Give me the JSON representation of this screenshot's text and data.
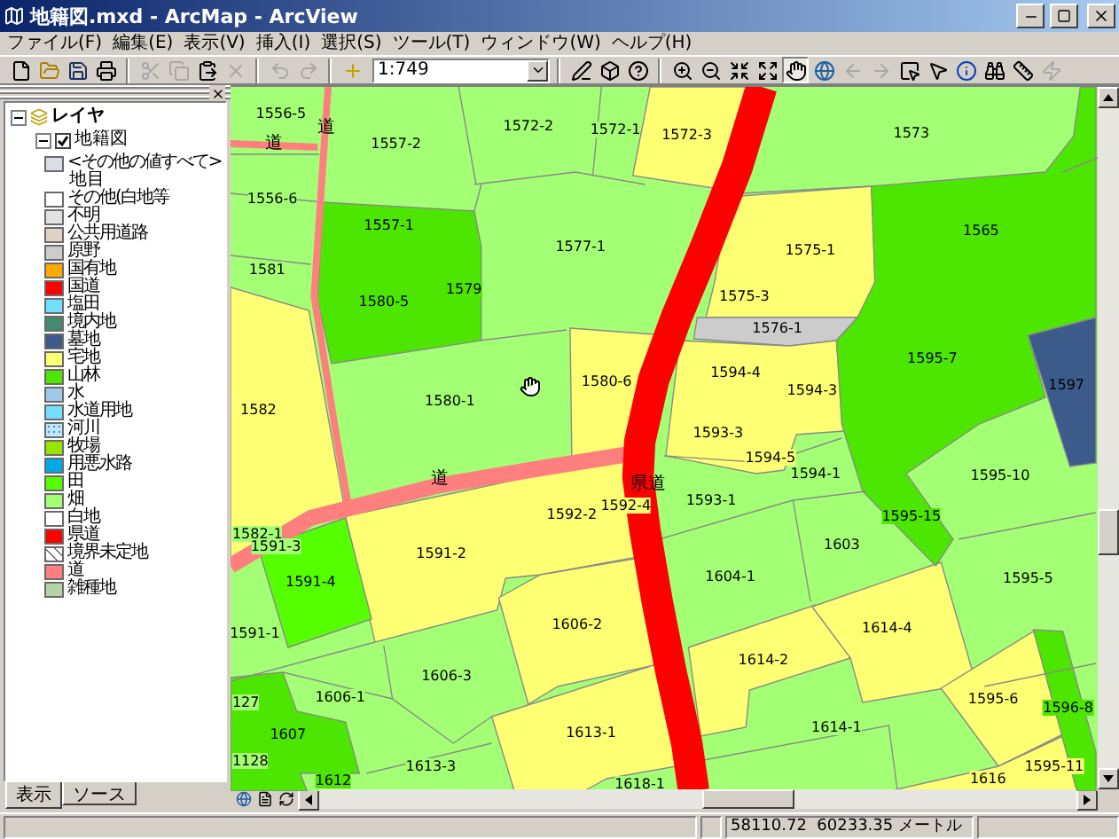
{
  "window": {
    "title": "地籍図.mxd - ArcMap - ArcView"
  },
  "menu": [
    "ファイル(F)",
    "編集(E)",
    "表示(V)",
    "挿入(I)",
    "選択(S)",
    "ツール(T)",
    "ウィンドウ(W)",
    "ヘルプ(H)"
  ],
  "toolbar": {
    "groups": [
      {
        "kind": "buttons",
        "buttons": [
          {
            "kind": "new",
            "disabled": false,
            "selected": false
          },
          {
            "kind": "open",
            "disabled": false,
            "selected": false
          },
          {
            "kind": "save",
            "disabled": false,
            "selected": false
          },
          {
            "kind": "print",
            "disabled": false,
            "selected": false
          }
        ]
      },
      {
        "kind": "buttons",
        "buttons": [
          {
            "kind": "cut",
            "disabled": true,
            "selected": false
          },
          {
            "kind": "copy",
            "disabled": true,
            "selected": false
          },
          {
            "kind": "paste",
            "disabled": false,
            "selected": false
          },
          {
            "kind": "delete",
            "disabled": true,
            "selected": false
          }
        ]
      },
      {
        "kind": "buttons",
        "buttons": [
          {
            "kind": "undo",
            "disabled": true,
            "selected": false
          },
          {
            "kind": "redo",
            "disabled": true,
            "selected": false
          }
        ]
      },
      {
        "kind": "buttons",
        "buttons": [
          {
            "kind": "add",
            "disabled": false,
            "selected": false
          }
        ]
      },
      {
        "kind": "scale",
        "value": "1:749"
      },
      {
        "kind": "buttons",
        "buttons": [
          {
            "kind": "editor",
            "disabled": false,
            "selected": false
          },
          {
            "kind": "toolbox",
            "disabled": false,
            "selected": false
          },
          {
            "kind": "help",
            "disabled": false,
            "selected": false
          }
        ]
      },
      {
        "kind": "buttons",
        "buttons": [
          {
            "kind": "zoomin",
            "disabled": false,
            "selected": false
          },
          {
            "kind": "zoomout",
            "disabled": false,
            "selected": false
          },
          {
            "kind": "fixedin",
            "disabled": false,
            "selected": false
          },
          {
            "kind": "fixedout",
            "disabled": false,
            "selected": false
          },
          {
            "kind": "pan",
            "disabled": false,
            "selected": true
          },
          {
            "kind": "globe",
            "disabled": false,
            "selected": false
          },
          {
            "kind": "back",
            "disabled": true,
            "selected": false
          },
          {
            "kind": "forward",
            "disabled": true,
            "selected": false
          },
          {
            "kind": "selectfeatures",
            "disabled": false,
            "selected": false
          },
          {
            "kind": "pointer",
            "disabled": false,
            "selected": false
          },
          {
            "kind": "identify",
            "disabled": false,
            "selected": false
          },
          {
            "kind": "find",
            "disabled": false,
            "selected": false
          },
          {
            "kind": "measure",
            "disabled": false,
            "selected": false
          },
          {
            "kind": "hyperlink",
            "disabled": true,
            "selected": false
          }
        ]
      }
    ]
  },
  "layers": {
    "label": "レイヤ",
    "expanded": true,
    "children": [
      {
        "label": "地籍図",
        "expanded": true,
        "checked": true,
        "default_symbol": {
          "label": "<その他の値すべて>",
          "color": "#dcdce6"
        },
        "field": "地目",
        "legend": [
          {
            "label": "その他(白地等",
            "color": "#ffffff",
            "kind": "fill"
          },
          {
            "label": "不明",
            "color": "#e1e1e1",
            "kind": "fill"
          },
          {
            "label": "公共用道路",
            "color": "#e1d2c8",
            "kind": "fill"
          },
          {
            "label": "原野",
            "color": "#cccccc",
            "kind": "fill"
          },
          {
            "label": "国有地",
            "color": "#ffaa00",
            "kind": "fill"
          },
          {
            "label": "国道",
            "color": "#ff0000",
            "kind": "fill"
          },
          {
            "label": "塩田",
            "color": "#73dfff",
            "kind": "fill"
          },
          {
            "label": "境内地",
            "color": "#448970",
            "kind": "fill"
          },
          {
            "label": "墓地",
            "color": "#3d5b8a",
            "kind": "fill"
          },
          {
            "label": "宅地",
            "color": "#ffff73",
            "kind": "fill"
          },
          {
            "label": "山林",
            "color": "#4ce600",
            "kind": "fill"
          },
          {
            "label": "水",
            "color": "#a0c8e8",
            "kind": "fill"
          },
          {
            "label": "水道用地",
            "color": "#73dfff",
            "kind": "fill"
          },
          {
            "label": "河川",
            "color": "#bee8ff",
            "kind": "dotted"
          },
          {
            "label": "牧場",
            "color": "#98e600",
            "kind": "fill"
          },
          {
            "label": "用悪水路",
            "color": "#00a9e6",
            "kind": "fill"
          },
          {
            "label": "田",
            "color": "#55ff00",
            "kind": "fill"
          },
          {
            "label": "畑",
            "color": "#a3ff73",
            "kind": "fill"
          },
          {
            "label": "白地",
            "color": "#ffffff",
            "kind": "fill"
          },
          {
            "label": "県道",
            "color": "#ff0000",
            "kind": "fill"
          },
          {
            "label": "境界未定地",
            "color": "#ffffff",
            "kind": "hatched"
          },
          {
            "label": "道",
            "color": "#ff7f7f",
            "kind": "fill"
          },
          {
            "label": "雑種地",
            "color": "#b4d2a8",
            "kind": "fill"
          }
        ]
      }
    ]
  },
  "panel_tabs": [
    {
      "label": "表示",
      "selected": true
    },
    {
      "label": "ソース",
      "selected": false
    }
  ],
  "map": {
    "roads": [
      {
        "label": "道",
        "color": "#ff7f7f"
      },
      {
        "label": "道",
        "color": "#ff7f7f"
      },
      {
        "label": "道",
        "color": "#ff7f7f"
      },
      {
        "label": "県道",
        "color": "#ff0000"
      }
    ],
    "parcels": [
      {
        "label": "1556-5",
        "color": "#a3ff73"
      },
      {
        "label": "1557-2",
        "color": "#a3ff73"
      },
      {
        "label": "1572-2",
        "color": "#a3ff73"
      },
      {
        "label": "1572-1",
        "color": "#a3ff73"
      },
      {
        "label": "1572-3",
        "color": "#ffff73"
      },
      {
        "label": "1573",
        "color": "#a3ff73"
      },
      {
        "label": "1556-6",
        "color": "#a3ff73"
      },
      {
        "label": "1557-1",
        "color": "#4ce600"
      },
      {
        "label": "1565",
        "color": "#4ce600"
      },
      {
        "label": "1577-1",
        "color": "#a3ff73"
      },
      {
        "label": "1575-1",
        "color": "#ffff73"
      },
      {
        "label": "1581",
        "color": "#a3ff73"
      },
      {
        "label": "1579",
        "color": "#4ce600"
      },
      {
        "label": "1575-3",
        "color": "#ffff73"
      },
      {
        "label": "1580-5",
        "color": "#4ce600"
      },
      {
        "label": "1576-1",
        "color": "#cccccc"
      },
      {
        "label": "1595-7",
        "color": "#4ce600"
      },
      {
        "label": "1580-6",
        "color": "#ffff73"
      },
      {
        "label": "1594-4",
        "color": "#ffff73"
      },
      {
        "label": "1597",
        "color": "#3d5b8a"
      },
      {
        "label": "1594-3",
        "color": "#ffff73"
      },
      {
        "label": "1580-1",
        "color": "#a3ff73"
      },
      {
        "label": "1582",
        "color": "#ffff73"
      },
      {
        "label": "1593-3",
        "color": "#ffff73"
      },
      {
        "label": "1594-5",
        "color": "#ffff73"
      },
      {
        "label": "1594-1",
        "color": "#a3ff73"
      },
      {
        "label": "1595-10",
        "color": "#a3ff73"
      },
      {
        "label": "1593-1",
        "color": "#a3ff73"
      },
      {
        "label": "1592-4",
        "color": "#ffff73"
      },
      {
        "label": "1592-2",
        "color": "#ffff73"
      },
      {
        "label": "1595-15",
        "color": "#4ce600"
      },
      {
        "label": "1582-1",
        "color": "#a3ff73"
      },
      {
        "label": "1591-3",
        "color": "#a3ff73"
      },
      {
        "label": "1603",
        "color": "#a3ff73"
      },
      {
        "label": "1591-2",
        "color": "#ffff73"
      },
      {
        "label": "1591-4",
        "color": "#55ff00"
      },
      {
        "label": "1604-1",
        "color": "#a3ff73"
      },
      {
        "label": "1595-5",
        "color": "#a3ff73"
      },
      {
        "label": "1606-2",
        "color": "#ffff73"
      },
      {
        "label": "1614-4",
        "color": "#ffff73"
      },
      {
        "label": "1591-1",
        "color": "#a3ff73"
      },
      {
        "label": "1614-2",
        "color": "#ffff73"
      },
      {
        "label": "1606-3",
        "color": "#a3ff73"
      },
      {
        "label": "127",
        "color": "#a3ff73"
      },
      {
        "label": "1606-1",
        "color": "#a3ff73"
      },
      {
        "label": "1595-6",
        "color": "#ffff73"
      },
      {
        "label": "1596-8",
        "color": "#4ce600"
      },
      {
        "label": "1607",
        "color": "#4ce600"
      },
      {
        "label": "1613-1",
        "color": "#ffff73"
      },
      {
        "label": "1614-1",
        "color": "#a3ff73"
      },
      {
        "label": "1128",
        "color": "#a3ff73"
      },
      {
        "label": "1612",
        "color": "#4ce600"
      },
      {
        "label": "1613-3",
        "color": "#a3ff73"
      },
      {
        "label": "1618-1",
        "color": "#a3ff73"
      },
      {
        "label": "1616",
        "color": "#ffff73"
      },
      {
        "label": "1595-11",
        "color": "#ffff73"
      }
    ]
  },
  "status_bar": {
    "coordinates": "58110.72  60233.35 メートル"
  }
}
